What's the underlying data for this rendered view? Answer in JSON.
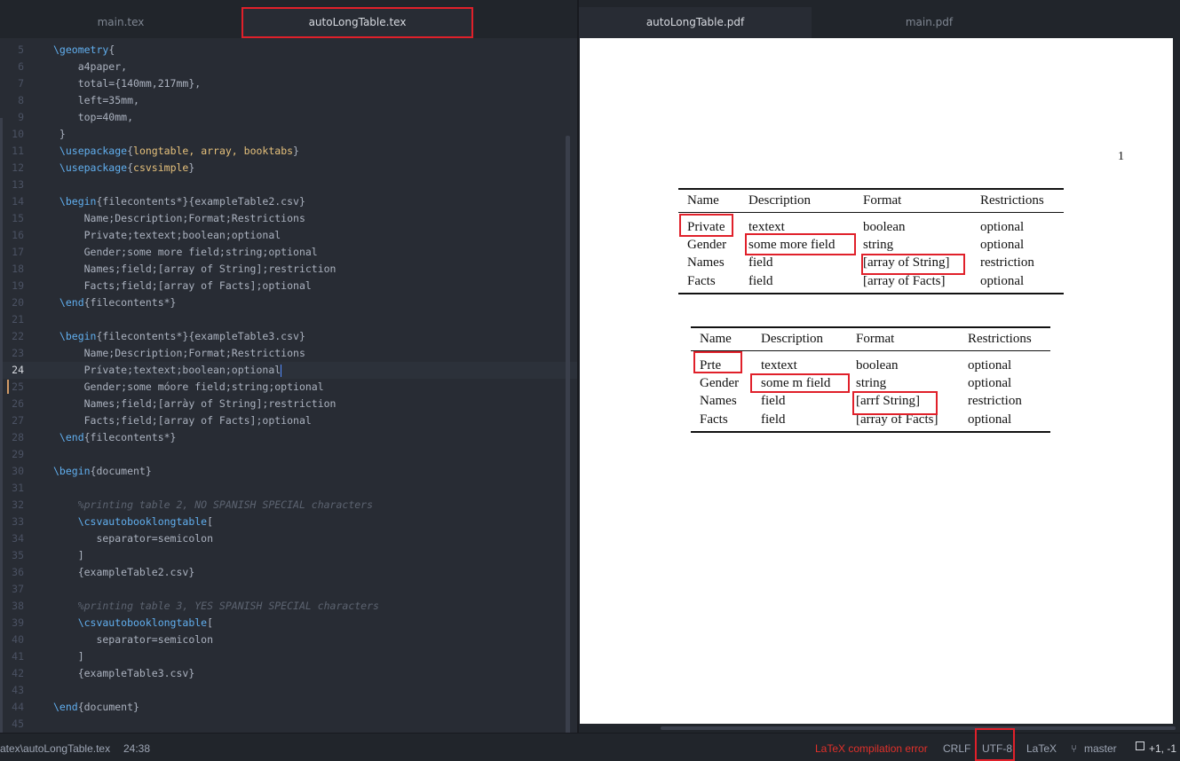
{
  "tabs_left": [
    {
      "label": "main.tex",
      "active": false
    },
    {
      "label": "autoLongTable.tex",
      "active": true
    }
  ],
  "tabs_right": [
    {
      "label": "autoLongTable.pdf",
      "active": true
    },
    {
      "label": "main.pdf",
      "active": false
    }
  ],
  "editor": {
    "current_line": 24,
    "lines": [
      {
        "n": "5",
        "segs": [
          [
            "k",
            "\\geometry"
          ],
          [
            "br",
            "{"
          ]
        ]
      },
      {
        "n": "6",
        "segs": [
          [
            "p",
            "    a4paper,"
          ]
        ]
      },
      {
        "n": "7",
        "segs": [
          [
            "p",
            "    total={140mm,217mm},"
          ]
        ]
      },
      {
        "n": "8",
        "segs": [
          [
            "p",
            "    left=35mm,"
          ]
        ]
      },
      {
        "n": "9",
        "segs": [
          [
            "p",
            "    top=40mm,"
          ]
        ]
      },
      {
        "n": "10",
        "segs": [
          [
            "p",
            " }"
          ]
        ]
      },
      {
        "n": "11",
        "segs": [
          [
            "k",
            " \\usepackage"
          ],
          [
            "br",
            "{"
          ],
          [
            "arg",
            "longtable, array, booktabs"
          ],
          [
            "br",
            "}"
          ]
        ]
      },
      {
        "n": "12",
        "segs": [
          [
            "k",
            " \\usepackage"
          ],
          [
            "br",
            "{"
          ],
          [
            "arg",
            "csvsimple"
          ],
          [
            "br",
            "}"
          ]
        ]
      },
      {
        "n": "13",
        "segs": []
      },
      {
        "n": "14",
        "segs": [
          [
            "k",
            " \\begin"
          ],
          [
            "p",
            "{filecontents*}{exampleTable2.csv}"
          ]
        ]
      },
      {
        "n": "15",
        "segs": [
          [
            "p",
            "     Name;Description;Format;Restrictions"
          ]
        ]
      },
      {
        "n": "16",
        "segs": [
          [
            "p",
            "     Private;textext;boolean;optional"
          ]
        ]
      },
      {
        "n": "17",
        "segs": [
          [
            "p",
            "     Gender;some more field;string;optional"
          ]
        ]
      },
      {
        "n": "18",
        "segs": [
          [
            "p",
            "     Names;field;[array of String];restriction"
          ]
        ]
      },
      {
        "n": "19",
        "segs": [
          [
            "p",
            "     Facts;field;[array of Facts];optional"
          ]
        ]
      },
      {
        "n": "20",
        "segs": [
          [
            "k",
            " \\end"
          ],
          [
            "p",
            "{filecontents*}"
          ]
        ]
      },
      {
        "n": "21",
        "segs": []
      },
      {
        "n": "22",
        "segs": [
          [
            "k",
            " \\begin"
          ],
          [
            "p",
            "{filecontents*}{exampleTable3.csv}"
          ]
        ]
      },
      {
        "n": "23",
        "segs": [
          [
            "p",
            "     Name;Description;Format;Restrictions"
          ]
        ]
      },
      {
        "n": "24",
        "segs": [
          [
            "p",
            "     Prívate;textext;boolean;optional"
          ]
        ]
      },
      {
        "n": "25",
        "segs": [
          [
            "p",
            "     Gender;some móore field;string;optional"
          ]
        ]
      },
      {
        "n": "26",
        "segs": [
          [
            "p",
            "     Names;field;[arrày of String];restriction"
          ]
        ]
      },
      {
        "n": "27",
        "segs": [
          [
            "p",
            "     Facts;field;[array of Facts];optional"
          ]
        ]
      },
      {
        "n": "28",
        "segs": [
          [
            "k",
            " \\end"
          ],
          [
            "p",
            "{filecontents*}"
          ]
        ]
      },
      {
        "n": "29",
        "segs": []
      },
      {
        "n": "30",
        "segs": [
          [
            "k",
            "\\begin"
          ],
          [
            "p",
            "{document}"
          ]
        ]
      },
      {
        "n": "31",
        "segs": []
      },
      {
        "n": "32",
        "segs": [
          [
            "cmt",
            "    %printing table 2, NO SPANISH SPECIAL characters"
          ]
        ]
      },
      {
        "n": "33",
        "segs": [
          [
            "k",
            "    \\csvautobooklongtable"
          ],
          [
            "br",
            "["
          ]
        ]
      },
      {
        "n": "34",
        "segs": [
          [
            "p",
            "       separator=semicolon"
          ]
        ]
      },
      {
        "n": "35",
        "segs": [
          [
            "p",
            "    ]"
          ]
        ]
      },
      {
        "n": "36",
        "segs": [
          [
            "p",
            "    {exampleTable2.csv}"
          ]
        ]
      },
      {
        "n": "37",
        "segs": []
      },
      {
        "n": "38",
        "segs": [
          [
            "cmt",
            "    %printing table 3, YES SPANISH SPECIAL characters"
          ]
        ]
      },
      {
        "n": "39",
        "segs": [
          [
            "k",
            "    \\csvautobooklongtable"
          ],
          [
            "br",
            "["
          ]
        ]
      },
      {
        "n": "40",
        "segs": [
          [
            "p",
            "       separator=semicolon"
          ]
        ]
      },
      {
        "n": "41",
        "segs": [
          [
            "p",
            "    ]"
          ]
        ]
      },
      {
        "n": "42",
        "segs": [
          [
            "p",
            "    {exampleTable3.csv}"
          ]
        ]
      },
      {
        "n": "43",
        "segs": []
      },
      {
        "n": "44",
        "segs": [
          [
            "k",
            "\\end"
          ],
          [
            "p",
            "{document}"
          ]
        ]
      },
      {
        "n": "45",
        "segs": []
      }
    ]
  },
  "pdf": {
    "page_number": "1",
    "table1": {
      "headers": [
        "Name",
        "Description",
        "Format",
        "Restrictions"
      ],
      "rows": [
        [
          "Private",
          "textext",
          "boolean",
          "optional"
        ],
        [
          "Gender",
          "some more field",
          "string",
          "optional"
        ],
        [
          "Names",
          "field",
          "[array of String]",
          "restriction"
        ],
        [
          "Facts",
          "field",
          "[array of Facts]",
          "optional"
        ]
      ]
    },
    "table2": {
      "headers": [
        "Name",
        "Description",
        "Format",
        "Restrictions"
      ],
      "rows": [
        [
          "Prte",
          "textext",
          "boolean",
          "optional"
        ],
        [
          "Gender",
          "some m field",
          "string",
          "optional"
        ],
        [
          "Names",
          "field",
          "[arrf String]",
          "restriction"
        ],
        [
          "Facts",
          "field",
          "[array of Facts]",
          "optional"
        ]
      ]
    }
  },
  "status": {
    "path": "atex\\autoLongTable.tex",
    "cursor": "24:38",
    "error": "LaTeX compilation error",
    "line_ending": "CRLF",
    "encoding": "UTF-8",
    "grammar": "LaTeX",
    "branch": "master",
    "git_diff": "+1, -1"
  },
  "colors": {
    "highlight": "#e0202a",
    "keyword": "#61afef",
    "argument": "#e5c07b",
    "error": "#e0302a"
  }
}
